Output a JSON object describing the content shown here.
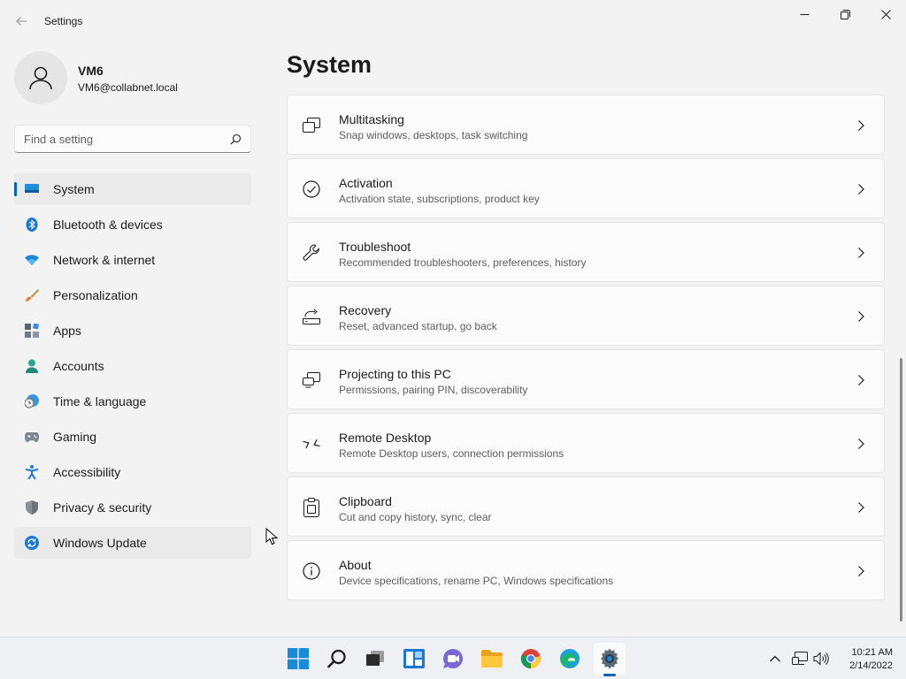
{
  "window": {
    "title": "Settings",
    "back_icon": "arrow-left-icon",
    "controls": [
      "minimize-icon",
      "maximize-icon",
      "close-icon"
    ]
  },
  "profile": {
    "name": "VM6",
    "email": "VM6@collabnet.local",
    "avatar_icon": "person-icon"
  },
  "search": {
    "placeholder": "Find a setting",
    "icon": "search-icon"
  },
  "sidebar": {
    "selected": "System",
    "hovered": "Windows Update",
    "items": [
      {
        "label": "System",
        "icon": "system-monitor-icon"
      },
      {
        "label": "Bluetooth & devices",
        "icon": "bluetooth-icon"
      },
      {
        "label": "Network & internet",
        "icon": "wifi-icon"
      },
      {
        "label": "Personalization",
        "icon": "brush-icon"
      },
      {
        "label": "Apps",
        "icon": "apps-icon"
      },
      {
        "label": "Accounts",
        "icon": "accounts-icon"
      },
      {
        "label": "Time & language",
        "icon": "clock-globe-icon"
      },
      {
        "label": "Gaming",
        "icon": "gamepad-icon"
      },
      {
        "label": "Accessibility",
        "icon": "accessibility-icon"
      },
      {
        "label": "Privacy & security",
        "icon": "shield-icon"
      },
      {
        "label": "Windows Update",
        "icon": "update-icon"
      }
    ]
  },
  "main": {
    "title": "System",
    "cards": [
      {
        "title": "Multitasking",
        "subtitle": "Snap windows, desktops, task switching",
        "icon": "multitasking-icon"
      },
      {
        "title": "Activation",
        "subtitle": "Activation state, subscriptions, product key",
        "icon": "check-circle-icon"
      },
      {
        "title": "Troubleshoot",
        "subtitle": "Recommended troubleshooters, preferences, history",
        "icon": "wrench-icon"
      },
      {
        "title": "Recovery",
        "subtitle": "Reset, advanced startup, go back",
        "icon": "recovery-icon"
      },
      {
        "title": "Projecting to this PC",
        "subtitle": "Permissions, pairing PIN, discoverability",
        "icon": "projecting-icon"
      },
      {
        "title": "Remote Desktop",
        "subtitle": "Remote Desktop users, connection permissions",
        "icon": "remote-desktop-icon"
      },
      {
        "title": "Clipboard",
        "subtitle": "Cut and copy history, sync, clear",
        "icon": "clipboard-icon"
      },
      {
        "title": "About",
        "subtitle": "Device specifications, rename PC, Windows specifications",
        "icon": "info-icon"
      }
    ]
  },
  "taskbar": {
    "apps": [
      "windows-start-icon",
      "search-icon",
      "task-view-icon",
      "widgets-icon",
      "teams-chat-icon",
      "file-explorer-icon",
      "chrome-icon",
      "edge-icon",
      "settings-gear-icon"
    ],
    "active_app": "settings-gear-icon",
    "tray": [
      "chevron-up-icon",
      "network-icon",
      "volume-icon"
    ],
    "time": "10:21 AM",
    "date": "2/14/2022"
  },
  "colors": {
    "accent": "#005fb8",
    "background": "#f3f3f3",
    "card": "#fbfbfb"
  }
}
